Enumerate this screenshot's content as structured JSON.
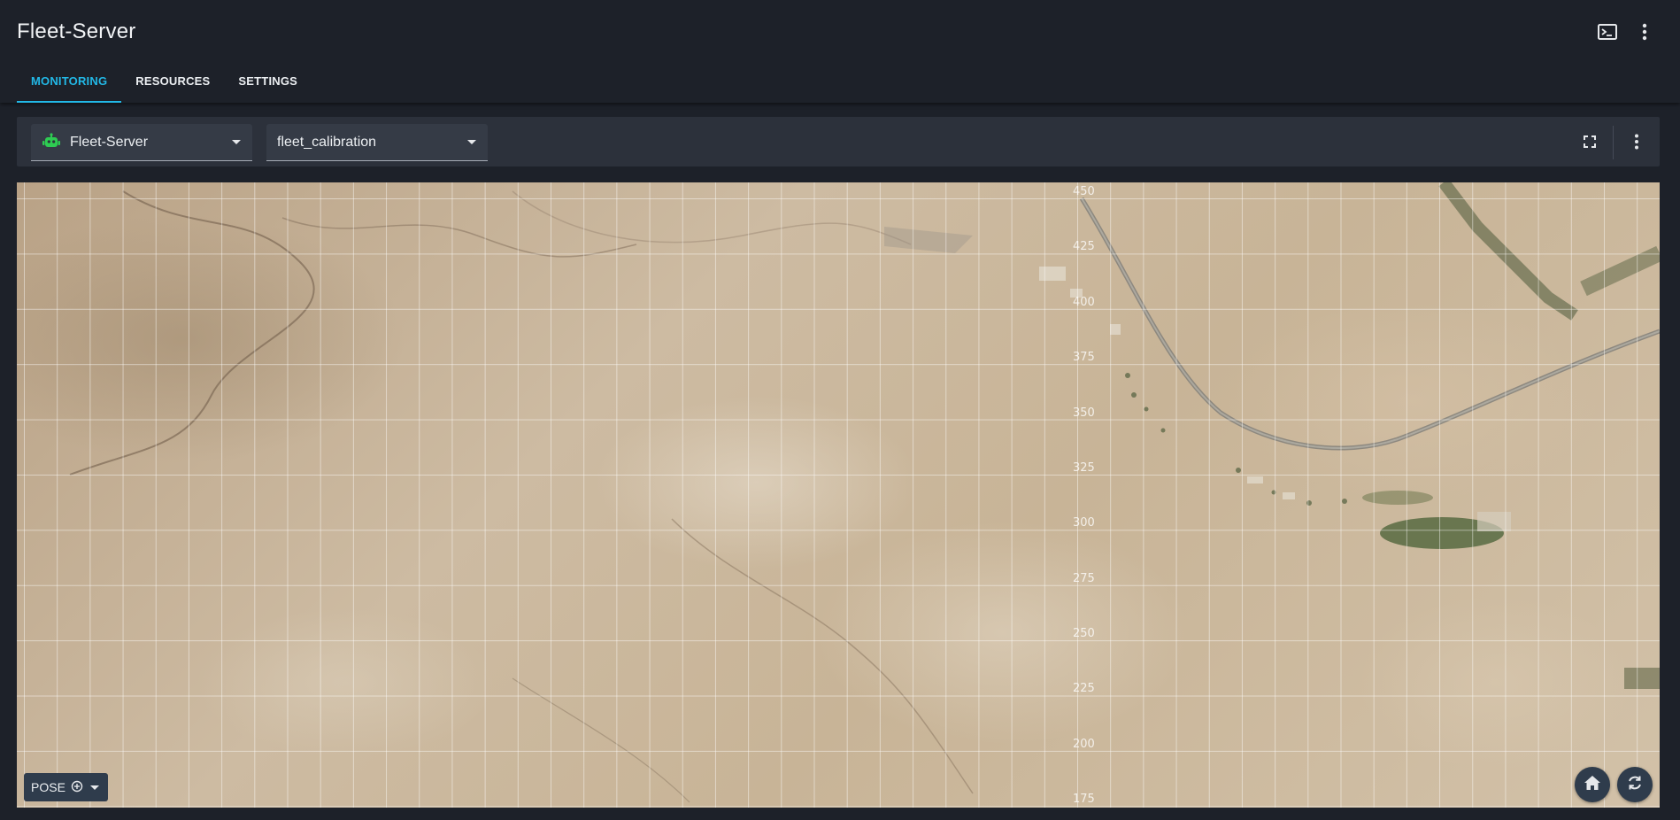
{
  "app": {
    "title": "Fleet-Server"
  },
  "header_icons": [
    "terminal-icon",
    "more-vert-icon"
  ],
  "tabs": [
    {
      "label": "MONITORING",
      "active": true
    },
    {
      "label": "RESOURCES",
      "active": false
    },
    {
      "label": "SETTINGS",
      "active": false
    }
  ],
  "toolbar": {
    "robot_select": {
      "value": "Fleet-Server",
      "icon": "robot-icon",
      "icon_color": "#2ecc52"
    },
    "map_select": {
      "value": "fleet_calibration"
    },
    "fullscreen_icon": "fullscreen-icon",
    "menu_icon": "more-vert-icon"
  },
  "map": {
    "type": "satellite",
    "y_axis_labels": [
      "450",
      "425",
      "400",
      "375",
      "350",
      "325",
      "300",
      "275",
      "250",
      "225",
      "200",
      "175"
    ],
    "pose_button": {
      "label": "POSE",
      "icon": "target-icon"
    },
    "home_icon": "home-icon",
    "refresh_icon": "refresh-icon"
  },
  "colors": {
    "accent": "#22b8e6",
    "background": "#1d2129",
    "panel": "#2c313b",
    "control": "#2f3c4c"
  }
}
